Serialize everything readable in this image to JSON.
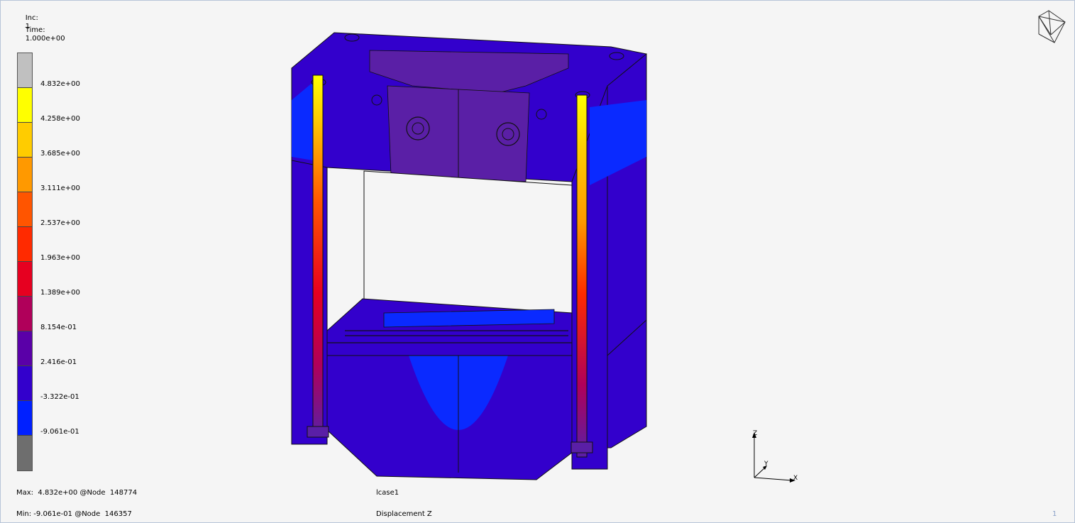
{
  "header": {
    "inc_label": "Inc:",
    "inc_value": "1",
    "time_label": "Time:",
    "time_value": "1.000e+00"
  },
  "legend": {
    "colors": [
      "#c0c0c0",
      "#ffff00",
      "#ffcc00",
      "#ff9900",
      "#ff5500",
      "#ff2a00",
      "#e60020",
      "#b0005a",
      "#5a00a8",
      "#3300cc",
      "#0020ff",
      "#6e6e6e"
    ],
    "labels": [
      "4.832e+00",
      "4.258e+00",
      "3.685e+00",
      "3.111e+00",
      "2.537e+00",
      "1.963e+00",
      "1.389e+00",
      "8.154e-01",
      "2.416e-01",
      "-3.322e-01",
      "-9.061e-01"
    ]
  },
  "footer": {
    "max_text": "Max:  4.832e+00 @Node  148774",
    "min_text": "Min: -9.061e-01 @Node  146357",
    "loadcase": "lcase1",
    "result": "Displacement Z",
    "page_number": "1"
  },
  "triad": {
    "z": "Z",
    "y": "Y",
    "x": "X"
  },
  "colors": {
    "frame_main": "#3300cc",
    "frame_blue": "#0a2aff",
    "frame_purple": "#5a1fa6",
    "background": "#f5f5f5"
  }
}
